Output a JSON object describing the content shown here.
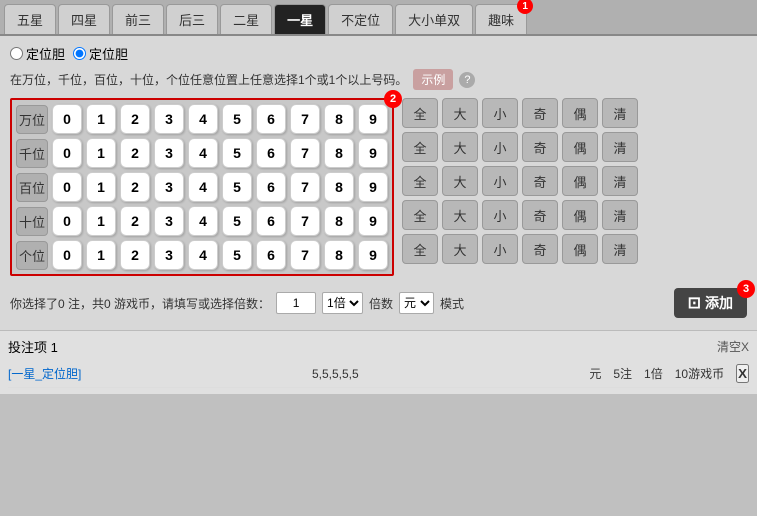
{
  "tabs": [
    {
      "id": "tab1",
      "label": "五星",
      "active": false
    },
    {
      "id": "tab2",
      "label": "四星",
      "active": false
    },
    {
      "id": "tab3",
      "label": "前三",
      "active": false
    },
    {
      "id": "tab4",
      "label": "后三",
      "active": false
    },
    {
      "id": "tab5",
      "label": "二星",
      "active": false
    },
    {
      "id": "tab6",
      "label": "一星",
      "active": true
    },
    {
      "id": "tab7",
      "label": "不定位",
      "active": false
    },
    {
      "id": "tab8",
      "label": "大小单双",
      "active": false
    },
    {
      "id": "tab9",
      "label": "趣味",
      "active": false,
      "badge": "1"
    }
  ],
  "radio": {
    "options": [
      "定位胆",
      "定位胆"
    ],
    "selected": "定位胆"
  },
  "desc": "在万位，千位，百位，十位，个位任意位置上任意选择1个或1个以上号码。",
  "example_btn": "示例",
  "help": "?",
  "rows": [
    {
      "label": "万位",
      "nums": [
        "0",
        "1",
        "2",
        "3",
        "4",
        "5",
        "6",
        "7",
        "8",
        "9"
      ]
    },
    {
      "label": "千位",
      "nums": [
        "0",
        "1",
        "2",
        "3",
        "4",
        "5",
        "6",
        "7",
        "8",
        "9"
      ]
    },
    {
      "label": "百位",
      "nums": [
        "0",
        "1",
        "2",
        "3",
        "4",
        "5",
        "6",
        "7",
        "8",
        "9"
      ]
    },
    {
      "label": "十位",
      "nums": [
        "0",
        "1",
        "2",
        "3",
        "4",
        "5",
        "6",
        "7",
        "8",
        "9"
      ]
    },
    {
      "label": "个位",
      "nums": [
        "0",
        "1",
        "2",
        "3",
        "4",
        "5",
        "6",
        "7",
        "8",
        "9"
      ]
    }
  ],
  "right_buttons": [
    [
      "全",
      "大",
      "小",
      "奇",
      "偶",
      "清"
    ],
    [
      "全",
      "大",
      "小",
      "奇",
      "偶",
      "清"
    ],
    [
      "全",
      "大",
      "小",
      "奇",
      "偶",
      "清"
    ],
    [
      "全",
      "大",
      "小",
      "奇",
      "偶",
      "清"
    ],
    [
      "全",
      "大",
      "小",
      "奇",
      "偶",
      "清"
    ]
  ],
  "info_bar": {
    "text1": "你选择了0 注，共0 游戏币，请填写或选择倍数：",
    "input_val": "1",
    "select1_options": [
      "1倍"
    ],
    "select1_val": "1倍",
    "text2": "倍数",
    "select2_options": [
      "元"
    ],
    "select2_val": "元",
    "text3": "模式",
    "add_label": "添加"
  },
  "bet_list": {
    "title": "投注项",
    "count": "1",
    "clear_label": "清空X",
    "items": [
      {
        "tag": "[一星_定位胆]",
        "nums": "5,5,5,5,5",
        "currency": "元",
        "bets": "5注",
        "times": "1倍",
        "coins": "10游戏币",
        "del": "X"
      }
    ]
  },
  "badges": {
    "tab_badge": "1",
    "grid_badge": "2",
    "add_badge": "3"
  }
}
